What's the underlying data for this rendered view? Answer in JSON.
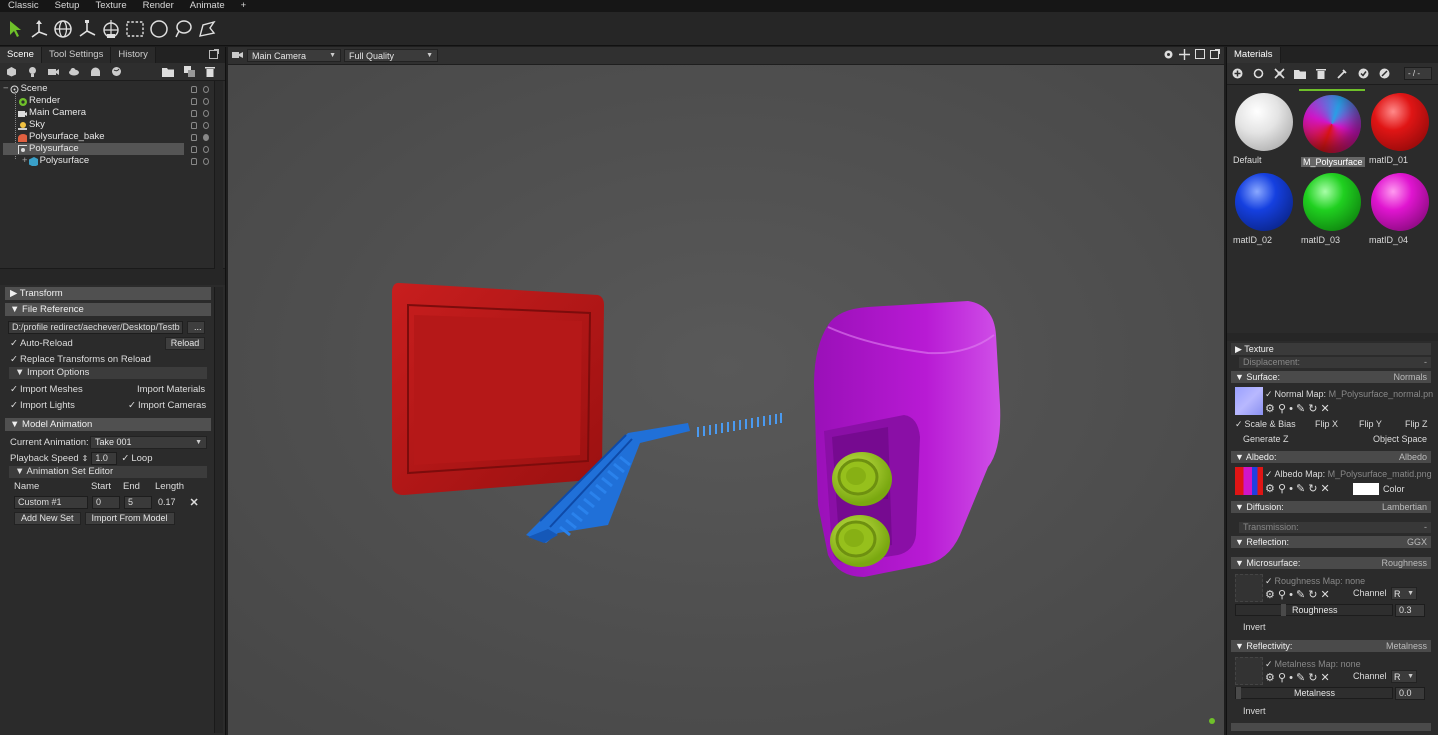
{
  "menu": [
    "Classic",
    "Setup",
    "Texture",
    "Render",
    "Animate",
    "+"
  ],
  "tools": [
    "select-arrow-icon",
    "move-gizmo-icon",
    "rotate-gizmo-icon",
    "scale-gizmo-icon",
    "world-transform-icon",
    "rect-select-icon",
    "circle-select-icon",
    "lasso-select-icon",
    "paint-select-icon"
  ],
  "left": {
    "tabs": [
      "Scene",
      "Tool Settings",
      "History"
    ],
    "icons": [
      "object-icon",
      "light-icon",
      "camera-icon",
      "cloud-icon",
      "bake-icon",
      "globe-icon",
      "folder-icon",
      "duplicate-icon",
      "delete-icon"
    ],
    "tree": [
      {
        "label": "Scene",
        "depth": 0,
        "icon": "scene-icon"
      },
      {
        "label": "Render",
        "depth": 1,
        "icon": "gear-icon"
      },
      {
        "label": "Main Camera",
        "depth": 1,
        "icon": "camera-icon"
      },
      {
        "label": "Sky",
        "depth": 1,
        "icon": "sky-icon"
      },
      {
        "label": "Polysurface_bake",
        "depth": 1,
        "icon": "bake-icon"
      },
      {
        "label": "Polysurface",
        "depth": 1,
        "icon": "group-icon",
        "selected": true
      },
      {
        "label": "Polysurface",
        "depth": 2,
        "icon": "mesh-icon"
      }
    ],
    "transform_label": "Transform",
    "file_reference": {
      "title": "File Reference",
      "path": "D:/profile redirect/aechever/Desktop/Testb",
      "browse": "...",
      "auto_reload": "Auto-Reload",
      "reload": "Reload",
      "replace_transforms": "Replace Transforms on Reload",
      "import_options": "Import Options",
      "import_meshes": "Import Meshes",
      "import_materials": "Import Materials",
      "import_lights": "Import Lights",
      "import_cameras": "Import Cameras"
    },
    "model_animation": {
      "title": "Model Animation",
      "current_label": "Current Animation:",
      "current_value": "Take 001",
      "speed_label": "Playback Speed",
      "speed_value": "1.0",
      "loop": "Loop",
      "set_editor": "Animation Set Editor",
      "col_name": "Name",
      "col_start": "Start",
      "col_end": "End",
      "col_length": "Length",
      "set_name": "Custom #1",
      "set_start": "0",
      "set_end": "5",
      "set_length": "0.17",
      "add_set": "Add New Set",
      "import_model": "Import From Model"
    }
  },
  "viewport": {
    "camera": "Main Camera",
    "quality": "Full Quality"
  },
  "right": {
    "tab": "Materials",
    "counter": "- / -",
    "materials": [
      {
        "name": "Default",
        "color": "#e8e8e8"
      },
      {
        "name": "M_Polysurface",
        "color": "#d01a8a",
        "selected": true
      },
      {
        "name": "matID_01",
        "color": "#e01515"
      },
      {
        "name": "matID_02",
        "color": "#1540e0"
      },
      {
        "name": "matID_03",
        "color": "#20d020"
      },
      {
        "name": "matID_04",
        "color": "#e015d0"
      }
    ],
    "texture": "Texture",
    "displacement": "Displacement:",
    "displacement_value": "-",
    "surface": "Surface:",
    "surface_value": "Normals",
    "normal_map_label": "Normal Map:",
    "normal_map_value": "M_Polysurface_normal.pn",
    "scale_bias": "Scale & Bias",
    "flip_x": "Flip X",
    "flip_y": "Flip Y",
    "flip_z": "Flip Z",
    "generate_z": "Generate Z",
    "object_space": "Object Space",
    "albedo": "Albedo:",
    "albedo_value": "Albedo",
    "albedo_map_label": "Albedo Map:",
    "albedo_map_value": "M_Polysurface_matid.png",
    "color_label": "Color",
    "diffusion": "Diffusion:",
    "diffusion_value": "Lambertian",
    "transmission": "Transmission:",
    "transmission_value": "-",
    "reflection": "Reflection:",
    "reflection_value": "GGX",
    "microsurface": "Microsurface:",
    "microsurface_value": "Roughness",
    "roughness_map": "Roughness Map: none",
    "channel": "Channel",
    "channel_value": "R",
    "roughness_label": "Roughness",
    "roughness_value": "0.3",
    "invert": "Invert",
    "reflectivity": "Reflectivity:",
    "reflectivity_value": "Metalness",
    "metalness_map": "Metalness Map: none",
    "metalness_label": "Metalness",
    "metalness_value": "0.0"
  },
  "colors": {
    "accent_green": "#6fc02a",
    "selection": "#555555"
  }
}
